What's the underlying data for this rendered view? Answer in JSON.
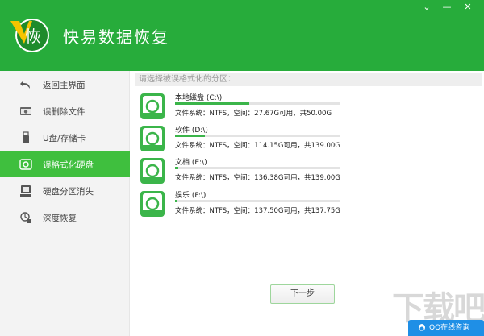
{
  "app": {
    "title": "快易数据恢复",
    "logo_char": "恢"
  },
  "window_controls": {
    "collapse_glyph": "⌄",
    "minimize_glyph": "—",
    "close_glyph": "✕"
  },
  "sidebar": {
    "items": [
      {
        "label": "返回主界面",
        "icon": "back-arrow-icon",
        "active": false
      },
      {
        "label": "误删除文件",
        "icon": "folder-icon",
        "active": false
      },
      {
        "label": "U盘/存储卡",
        "icon": "usb-icon",
        "active": false
      },
      {
        "label": "误格式化硬盘",
        "icon": "harddisk-icon",
        "active": true
      },
      {
        "label": "硬盘分区消失",
        "icon": "partition-icon",
        "active": false
      },
      {
        "label": "深度恢复",
        "icon": "deep-recovery-icon",
        "active": false
      }
    ]
  },
  "main": {
    "prompt": "请选择被误格式化的分区：",
    "drives": [
      {
        "name": "本地磁盘 (C:\\)",
        "info": "文件系统：NTFS，空间：27.67G可用，共50.00G",
        "used_fraction": 0.45
      },
      {
        "name": "软件 (D:\\)",
        "info": "文件系统：NTFS，空间：114.15G可用，共139.00G",
        "used_fraction": 0.18
      },
      {
        "name": "文档 (E:\\)",
        "info": "文件系统：NTFS，空间：136.38G可用，共139.00G",
        "used_fraction": 0.02
      },
      {
        "name": "娱乐 (F:\\)",
        "info": "文件系统：NTFS，空间：137.50G可用，共137.75G",
        "used_fraction": 0.01
      }
    ],
    "next_label": "下一步"
  },
  "watermark": "下载吧",
  "qq": {
    "label": "QQ在线咨询"
  },
  "colors": {
    "brand": "#27ac3b",
    "active": "#3fbf3e",
    "usage_bar": "#3bb54a",
    "qq": "#1f8fe6"
  }
}
